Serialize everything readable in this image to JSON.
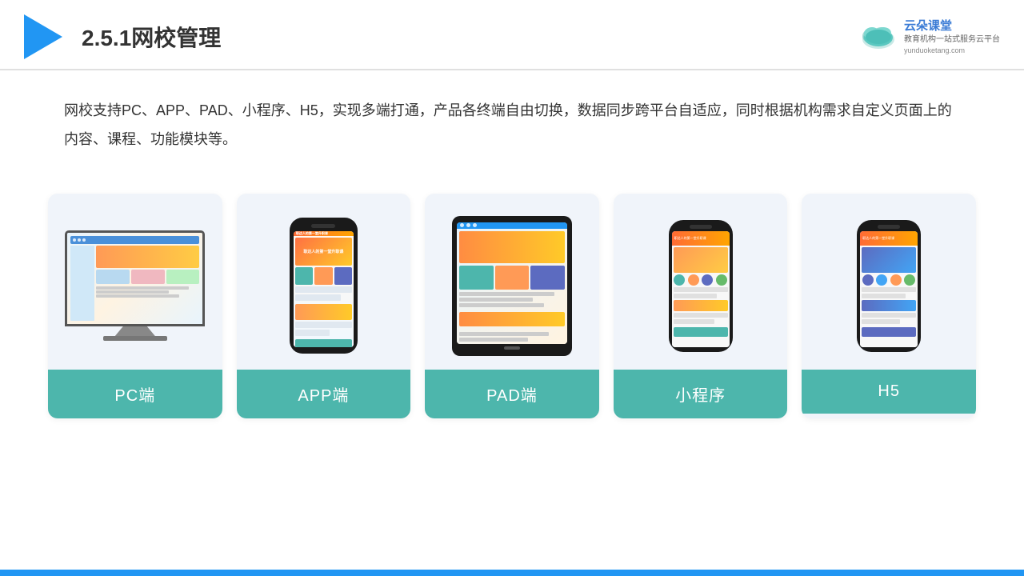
{
  "header": {
    "section_number": "2.5.1",
    "title": "网校管理",
    "brand": {
      "name": "云朵课堂",
      "url": "yunduoketang.com",
      "slogan1": "教育机构一站",
      "slogan2": "式服务云平台"
    }
  },
  "description": {
    "text": "网校支持PC、APP、PAD、小程序、H5，实现多端打通，产品各终端自由切换，数据同步跨平台自适应，同时根据机构需求自定义页面上的内容、课程、功能模块等。"
  },
  "cards": [
    {
      "id": "pc",
      "label": "PC端"
    },
    {
      "id": "app",
      "label": "APP端"
    },
    {
      "id": "pad",
      "label": "PAD端"
    },
    {
      "id": "miniapp",
      "label": "小程序"
    },
    {
      "id": "h5",
      "label": "H5"
    }
  ]
}
